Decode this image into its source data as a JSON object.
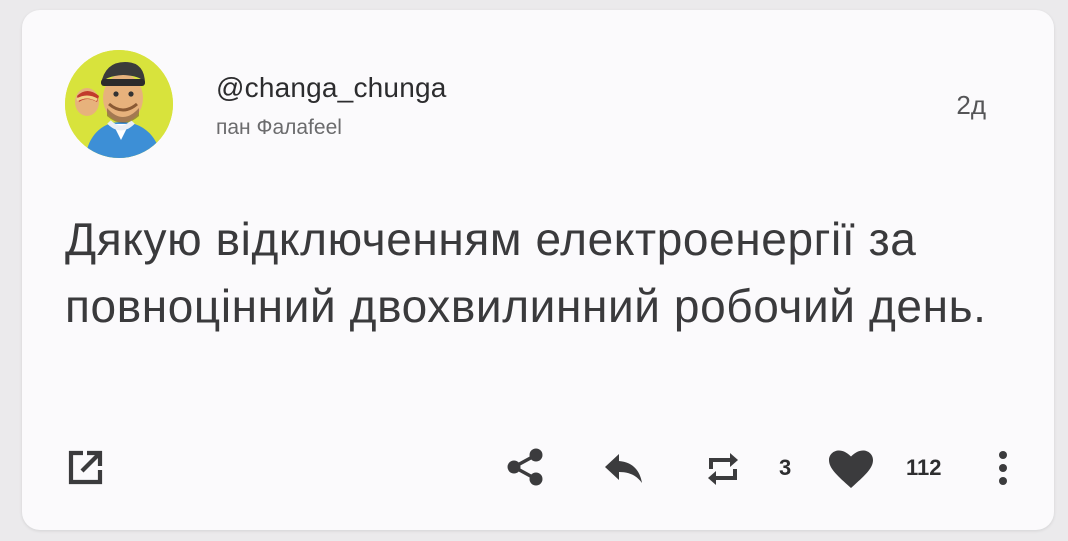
{
  "post": {
    "handle": "@changa_chunga",
    "display_name": "пан Фалаfeel",
    "timestamp": "2д",
    "text": "Дякую відключенням електроенергії за повноцінний двохвилинний робочий день."
  },
  "actions": {
    "open_icon": "external-link-icon",
    "share_icon": "share-icon",
    "reply_icon": "reply-icon",
    "repost_icon": "repost-icon",
    "repost_count": "3",
    "like_icon": "heart-icon",
    "like_count": "112",
    "more_icon": "more-vertical-icon"
  },
  "colors": {
    "background": "#ebeaec",
    "card": "#fbfafc",
    "text": "#3a3a3c",
    "icon": "#3b3b3d",
    "avatar_bg": "#d8e33c"
  }
}
